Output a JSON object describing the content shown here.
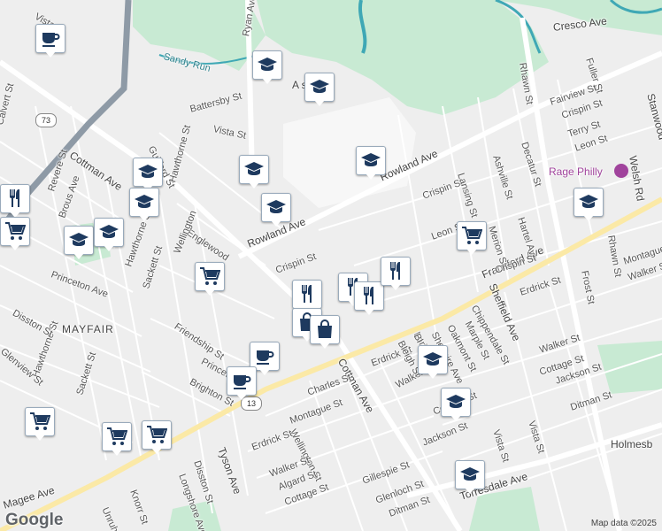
{
  "map": {
    "attribution": "Map data ©2025",
    "logo": "Google",
    "poi_label": "Rage Philly",
    "school_label": "A school",
    "place_label": "MAYFAIR",
    "highway_shield_a": "73",
    "highway_shield_b": "13",
    "street_labels": [
      {
        "text": "Rowland Ave"
      },
      {
        "text": "Rowland Ave"
      },
      {
        "text": "Cottman Ave"
      },
      {
        "text": "Cottman Ave"
      },
      {
        "text": "Frankford Ave"
      },
      {
        "text": "Torresdale Ave"
      },
      {
        "text": "Magee Ave"
      },
      {
        "text": "Cresco Ave"
      },
      {
        "text": "Ryan Ave"
      },
      {
        "text": "Rhawn St"
      },
      {
        "text": "Rhawn St"
      },
      {
        "text": "Welsh Rd"
      },
      {
        "text": "Sandy Run"
      },
      {
        "text": "Battersby St"
      },
      {
        "text": "Vista St"
      },
      {
        "text": "Vista St"
      },
      {
        "text": "Vista St"
      },
      {
        "text": "Calvert St"
      },
      {
        "text": "Revere St"
      },
      {
        "text": "Brous Ave"
      },
      {
        "text": "Guilford St"
      },
      {
        "text": "Hawthorne St"
      },
      {
        "text": "Hawthorne St"
      },
      {
        "text": "Hawthorne St"
      },
      {
        "text": "Englewood"
      },
      {
        "text": "Wellington"
      },
      {
        "text": "Wellington St"
      },
      {
        "text": "Princeton Ave"
      },
      {
        "text": "Princeton"
      },
      {
        "text": "Sackett St"
      },
      {
        "text": "Sackett St"
      },
      {
        "text": "Friendship St"
      },
      {
        "text": "Disston St"
      },
      {
        "text": "Disston St"
      },
      {
        "text": "Brighton St"
      },
      {
        "text": "Tyson Ave"
      },
      {
        "text": "Longshore Ave"
      },
      {
        "text": "Unruh Ave"
      },
      {
        "text": "Knorr St"
      },
      {
        "text": "Crispin St"
      },
      {
        "text": "Crispin St"
      },
      {
        "text": "Crispin St"
      },
      {
        "text": "Lansing St"
      },
      {
        "text": "Ashville St"
      },
      {
        "text": "Decatur St"
      },
      {
        "text": "Fuller St"
      },
      {
        "text": "Fairview St"
      },
      {
        "text": "Terry St"
      },
      {
        "text": "Leon St"
      },
      {
        "text": "Leon St"
      },
      {
        "text": "Merion St"
      },
      {
        "text": "Hartel Ave"
      },
      {
        "text": "Frost St"
      },
      {
        "text": "Montague"
      },
      {
        "text": "Montague St"
      },
      {
        "text": "Walker St"
      },
      {
        "text": "Walker St"
      },
      {
        "text": "Walker St"
      },
      {
        "text": "Walker St"
      },
      {
        "text": "Erdrick St"
      },
      {
        "text": "Erdrick St"
      },
      {
        "text": "Erdrick St"
      },
      {
        "text": "Chippendale St"
      },
      {
        "text": "Sheffield Ave"
      },
      {
        "text": "Marple St"
      },
      {
        "text": "Oakmont St"
      },
      {
        "text": "Shelmire Ave"
      },
      {
        "text": "Loring St"
      },
      {
        "text": "Bleigh St"
      },
      {
        "text": "Cottage St"
      },
      {
        "text": "Cottage St"
      },
      {
        "text": "Cottage St"
      },
      {
        "text": "Jackson St"
      },
      {
        "text": "Jackson St"
      },
      {
        "text": "Ditman St"
      },
      {
        "text": "Ditman St"
      },
      {
        "text": "Charles St"
      },
      {
        "text": "Gillespie St"
      },
      {
        "text": "Glenloch St"
      },
      {
        "text": "Algard St"
      },
      {
        "text": "Holmesb"
      },
      {
        "text": "Stanwood"
      },
      {
        "text": "Crispin St"
      },
      {
        "text": "Glenview St"
      },
      {
        "text": "Vista St"
      },
      {
        "text": "Bl"
      }
    ],
    "pins": [
      {
        "icon": "coffee-icon"
      },
      {
        "icon": "coffee-icon"
      },
      {
        "icon": "coffee-icon"
      },
      {
        "icon": "school-icon"
      },
      {
        "icon": "school-icon"
      },
      {
        "icon": "school-icon"
      },
      {
        "icon": "school-icon"
      },
      {
        "icon": "school-icon"
      },
      {
        "icon": "school-icon"
      },
      {
        "icon": "school-icon"
      },
      {
        "icon": "school-icon"
      },
      {
        "icon": "school-icon"
      },
      {
        "icon": "school-icon"
      },
      {
        "icon": "school-icon"
      },
      {
        "icon": "school-icon"
      },
      {
        "icon": "school-icon"
      },
      {
        "icon": "restaurant-icon"
      },
      {
        "icon": "restaurant-icon"
      },
      {
        "icon": "restaurant-icon"
      },
      {
        "icon": "restaurant-icon"
      },
      {
        "icon": "restaurant-icon"
      },
      {
        "icon": "shopping-cart-icon"
      },
      {
        "icon": "shopping-cart-icon"
      },
      {
        "icon": "shopping-cart-icon"
      },
      {
        "icon": "shopping-cart-icon"
      },
      {
        "icon": "shopping-cart-icon"
      },
      {
        "icon": "shopping-cart-icon"
      },
      {
        "icon": "shopping-bag-icon"
      },
      {
        "icon": "shopping-bag-icon"
      }
    ],
    "colors": {
      "background": "#eeeeee",
      "park": "#c8ead3",
      "water": "#3fa8b5",
      "highway": "#8e9aa6",
      "major_road": "#ffffff",
      "pin_icon": "#1e3a5f",
      "poi": "#a0439c"
    }
  }
}
